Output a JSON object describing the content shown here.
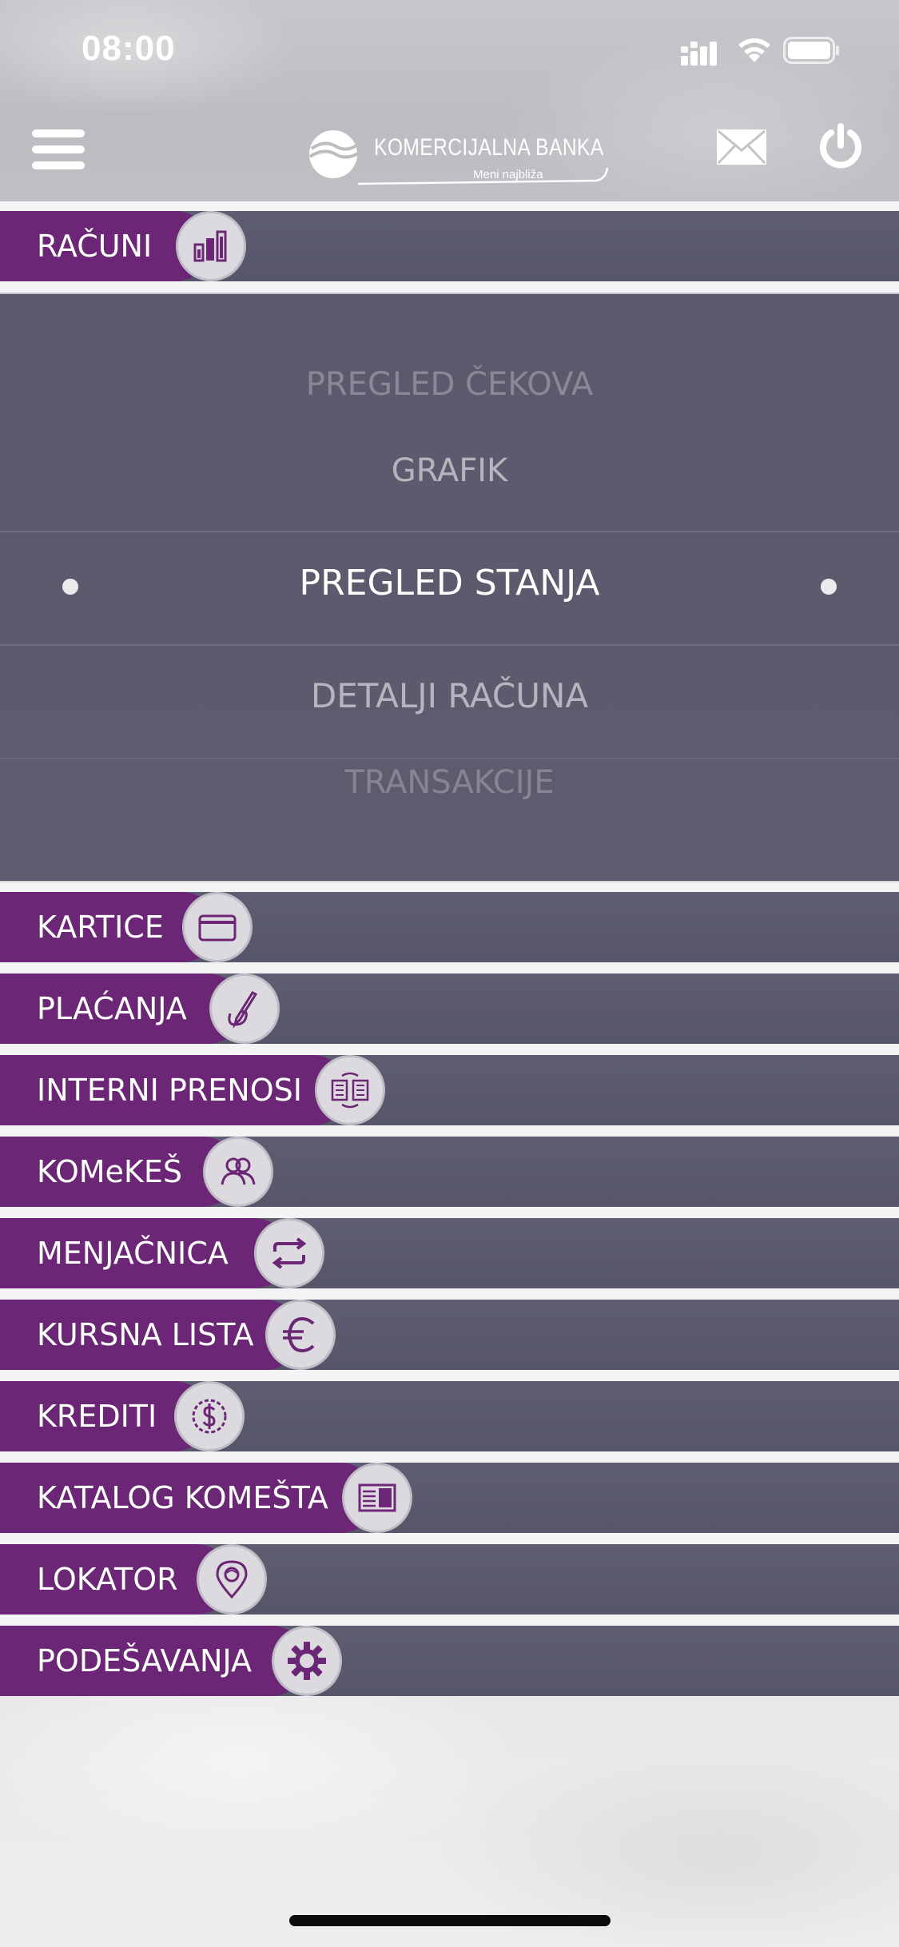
{
  "status_bar": {
    "time": "08:00"
  },
  "header": {
    "logo_name": "KOMERCIJALNA BANKA",
    "logo_tagline": "Meni najbliža",
    "menu_icon": "hamburger-menu-icon",
    "mail_icon": "envelope-icon",
    "power_icon": "power-icon"
  },
  "colors": {
    "accent": "#6b2675",
    "row_bg": "#5a596d",
    "icon_bg": "#dcdadf"
  },
  "accounts": {
    "label": "RAČUNI",
    "icon": "bar-chart-icon"
  },
  "picker": {
    "items": [
      {
        "label": "PREGLED ČEKOVA"
      },
      {
        "label": "GRAFIK"
      },
      {
        "label": "PREGLED STANJA"
      },
      {
        "label": "DETALJI RAČUNA"
      },
      {
        "label": "TRANSAKCIJE"
      }
    ],
    "selected": "PREGLED STANJA"
  },
  "menu": [
    {
      "label": "KARTICE",
      "icon": "credit-card-icon"
    },
    {
      "label": "PLAĆANJA",
      "icon": "signature-pen-icon"
    },
    {
      "label": "INTERNI PRENOSI",
      "icon": "transfer-documents-icon"
    },
    {
      "label": "KOMeKEŠ",
      "icon": "users-icon"
    },
    {
      "label": "MENJAČNICA",
      "icon": "exchange-arrows-icon"
    },
    {
      "label": "KURSNA LISTA",
      "icon": "euro-icon"
    },
    {
      "label": "KREDITI",
      "icon": "dollar-coin-icon"
    },
    {
      "label": "KATALOG KOMEŠTA",
      "icon": "catalog-book-icon"
    },
    {
      "label": "LOKATOR",
      "icon": "location-pin-icon"
    },
    {
      "label": "PODEŠAVANJA",
      "icon": "gear-icon"
    }
  ]
}
